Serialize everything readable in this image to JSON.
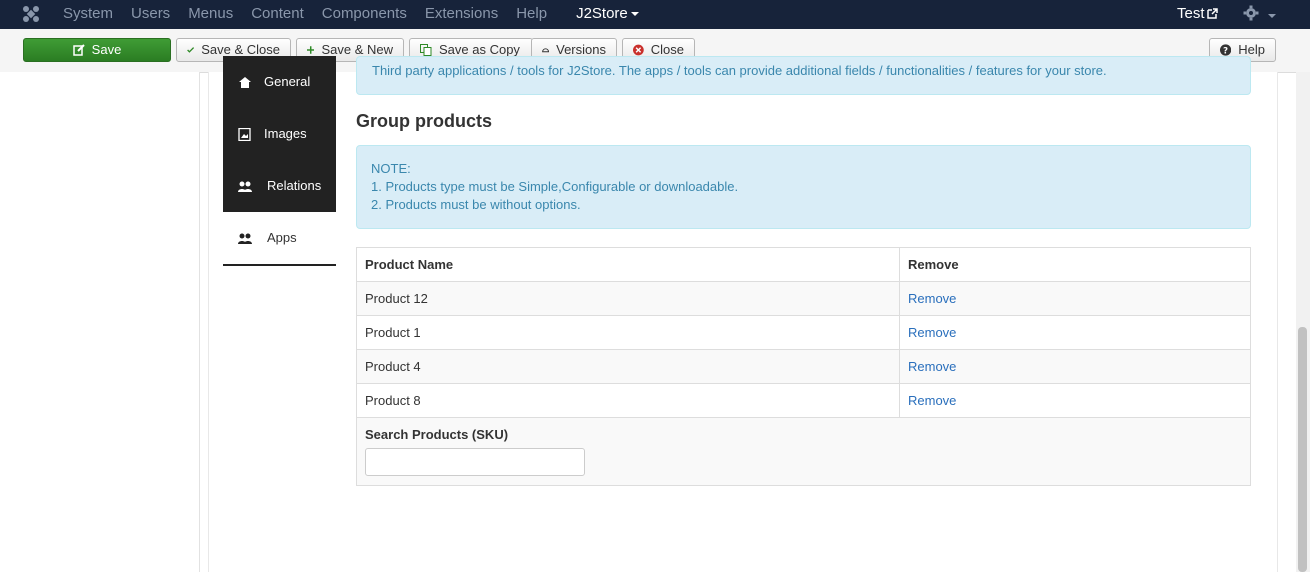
{
  "navbar": {
    "menu": [
      "System",
      "Users",
      "Menus",
      "Content",
      "Components",
      "Extensions",
      "Help"
    ],
    "active_menu": "J2Store",
    "user": "Test"
  },
  "toolbar": {
    "save": "Save",
    "save_close": "Save & Close",
    "save_new": "Save & New",
    "save_copy": "Save as Copy",
    "versions": "Versions",
    "close": "Close",
    "help": "Help"
  },
  "tabs": [
    {
      "label": "General",
      "icon": "home-icon"
    },
    {
      "label": "Images",
      "icon": "image-icon"
    },
    {
      "label": "Relations",
      "icon": "users-icon"
    },
    {
      "label": "Apps",
      "icon": "users-icon",
      "active": true
    }
  ],
  "info_top": "Third party applications / tools for J2Store. The apps / tools can provide additional fields / functionalities / features for your store.",
  "group": {
    "heading": "Group products",
    "note_title": "NOTE:",
    "note_lines": [
      "1. Products type must be Simple,Configurable or downloadable.",
      "2. Products must be without options."
    ],
    "columns": [
      "Product Name",
      "Remove"
    ],
    "rows": [
      {
        "name": "Product 12",
        "action": "Remove"
      },
      {
        "name": "Product 1",
        "action": "Remove"
      },
      {
        "name": "Product 4",
        "action": "Remove"
      },
      {
        "name": "Product 8",
        "action": "Remove"
      }
    ],
    "search_label": "Search Products (SKU)",
    "search_value": ""
  },
  "colors": {
    "navbar": "#17233a",
    "save_button": "#2f8a27",
    "info_bg": "#d9edf7",
    "info_text": "#3a87ad",
    "link": "#2a6fbc"
  }
}
